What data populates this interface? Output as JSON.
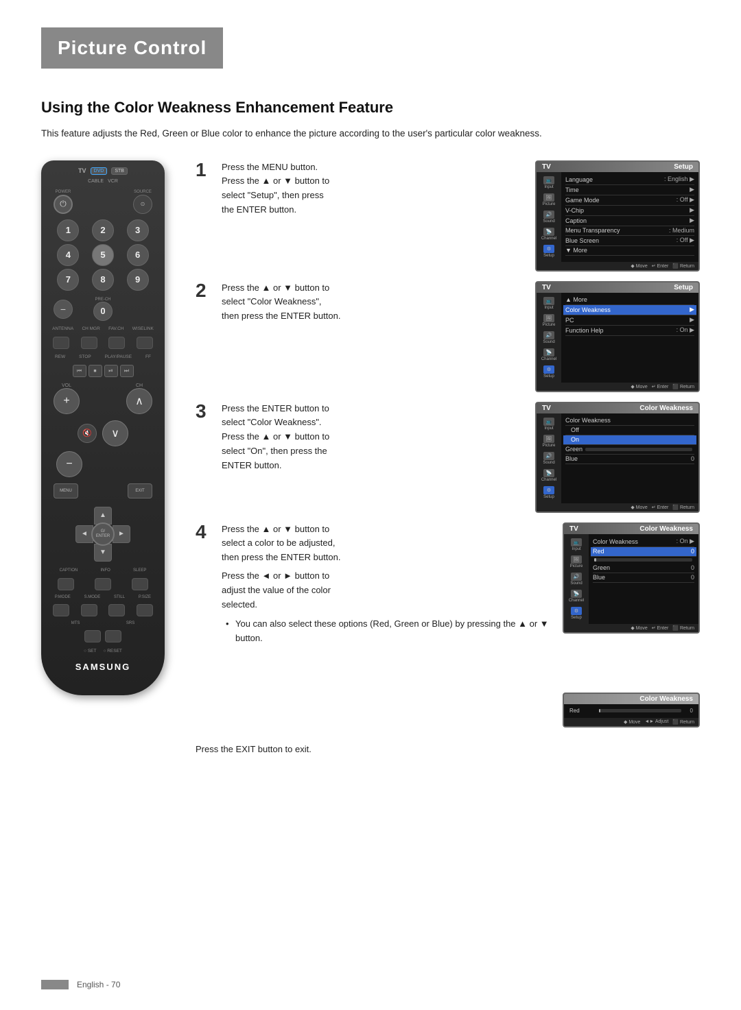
{
  "page": {
    "title": "Picture Control",
    "section": "Using the Color Weakness Enhancement Feature",
    "intro": "This feature adjusts the Red, Green or Blue color to enhance the picture according to the user's particular color weakness.",
    "footer": "English - 70"
  },
  "steps": [
    {
      "number": "1",
      "lines": [
        "Press the MENU button.",
        "Press the ▲ or ▼ button to",
        "select \"Setup\", then press",
        "the ENTER button."
      ],
      "screen_title": "Setup",
      "screen_items": [
        {
          "label": "Input",
          "icon": "input"
        },
        {
          "label": "Language",
          "value": ": English ▶"
        },
        {
          "label": "Time",
          "value": "▶"
        },
        {
          "label": "Picture",
          "icon": "picture"
        },
        {
          "label": "Game Mode",
          "value": ": Off ▶"
        },
        {
          "label": "V-Chip",
          "value": "▶"
        },
        {
          "label": "Sound",
          "icon": "sound"
        },
        {
          "label": "Caption",
          "value": "▶"
        },
        {
          "label": "Menu Transparency",
          "value": ": Medium"
        },
        {
          "label": "Channel",
          "icon": "channel"
        },
        {
          "label": "Blue Screen",
          "value": ": Off ▶"
        },
        {
          "label": "▼ More",
          "value": ""
        },
        {
          "label": "Setup",
          "icon": "setup",
          "active": true
        }
      ]
    },
    {
      "number": "2",
      "lines": [
        "Press the ▲ or ▼ button to",
        "select \"Color Weakness\",",
        "then press the ENTER button."
      ],
      "screen_title": "Setup",
      "screen_items": [
        {
          "label": "Input"
        },
        {
          "label": "▲ More"
        },
        {
          "label": "Color Weakness",
          "value": "▶",
          "highlighted": true
        },
        {
          "label": "Picture"
        },
        {
          "label": "PC",
          "value": "▶"
        },
        {
          "label": "Sound"
        },
        {
          "label": "Function Help",
          "value": ": On ▶"
        },
        {
          "label": "Channel"
        },
        {
          "label": "Setup",
          "active": true
        }
      ]
    },
    {
      "number": "3",
      "lines": [
        "Press the ENTER button to",
        "select \"Color Weakness\".",
        "Press the ▲ or ▼ button to",
        "select \"On\", then press the",
        "ENTER button."
      ],
      "screen_title": "Color Weakness",
      "screen_items": [
        {
          "label": "Input"
        },
        {
          "label": "Color Weakness"
        },
        {
          "label": "Off",
          "off": true
        },
        {
          "label": "On",
          "on": true,
          "highlighted": true
        },
        {
          "label": "Picture"
        },
        {
          "label": "Green"
        },
        {
          "label": "Blue",
          "value": "0"
        },
        {
          "label": "Sound"
        },
        {
          "label": "Channel"
        },
        {
          "label": "Setup",
          "active": true
        }
      ]
    },
    {
      "number": "4",
      "lines": [
        "Press the ▲ or ▼ button to",
        "select a color to be adjusted,",
        "then press the ENTER button."
      ],
      "extra_lines": [
        "Press the ◄ or ► button to",
        "adjust the value of the color",
        "selected."
      ],
      "bullet": "You can also select these options (Red, Green or Blue) by pressing the ▲ or ▼ button.",
      "screen_title": "Color Weakness",
      "screen_items": [
        {
          "label": "Input"
        },
        {
          "label": "Color Weakness",
          "value": ": On ▶"
        },
        {
          "label": "Picture"
        },
        {
          "label": "Red",
          "value": "0",
          "highlighted": true,
          "bar": 0
        },
        {
          "label": "Green",
          "value": "0",
          "bar": 0
        },
        {
          "label": "Blue",
          "value": "0",
          "bar": 0
        },
        {
          "label": "Sound"
        },
        {
          "label": "Channel"
        },
        {
          "label": "Setup",
          "active": true
        }
      ]
    }
  ],
  "small_screen": {
    "title": "Color Weakness",
    "item": "Red",
    "value": "0"
  },
  "exit_text": "Press the EXIT button to exit.",
  "remote": {
    "tv_label": "TV",
    "dvd_label": "DVD",
    "stb_label": "STB",
    "cable_label": "CABLE",
    "vcr_label": "VCR",
    "samsung": "SAMSUNG"
  }
}
